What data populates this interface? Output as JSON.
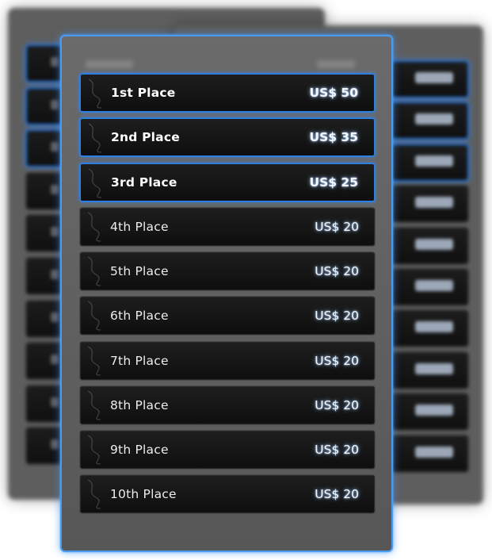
{
  "prizes": [
    {
      "place": "1st Place",
      "amount": "US$ 50",
      "highlight": true
    },
    {
      "place": "2nd Place",
      "amount": "US$ 35",
      "highlight": true
    },
    {
      "place": "3rd Place",
      "amount": "US$ 25",
      "highlight": true
    },
    {
      "place": "4th Place",
      "amount": "US$ 20",
      "highlight": false
    },
    {
      "place": "5th Place",
      "amount": "US$ 20",
      "highlight": false
    },
    {
      "place": "6th Place",
      "amount": "US$ 20",
      "highlight": false
    },
    {
      "place": "7th Place",
      "amount": "US$ 20",
      "highlight": false
    },
    {
      "place": "8th Place",
      "amount": "US$ 20",
      "highlight": false
    },
    {
      "place": "9th Place",
      "amount": "US$ 20",
      "highlight": false
    },
    {
      "place": "10th Place",
      "amount": "US$ 20",
      "highlight": false
    }
  ],
  "colors": {
    "accent_blue": "#2f7fe0",
    "panel_gray": "#5e5e5e",
    "row_dark": "#141414",
    "amount_glow": "#96c8ff"
  },
  "icons": {
    "row_decoration": "swirl-ornament-icon"
  }
}
